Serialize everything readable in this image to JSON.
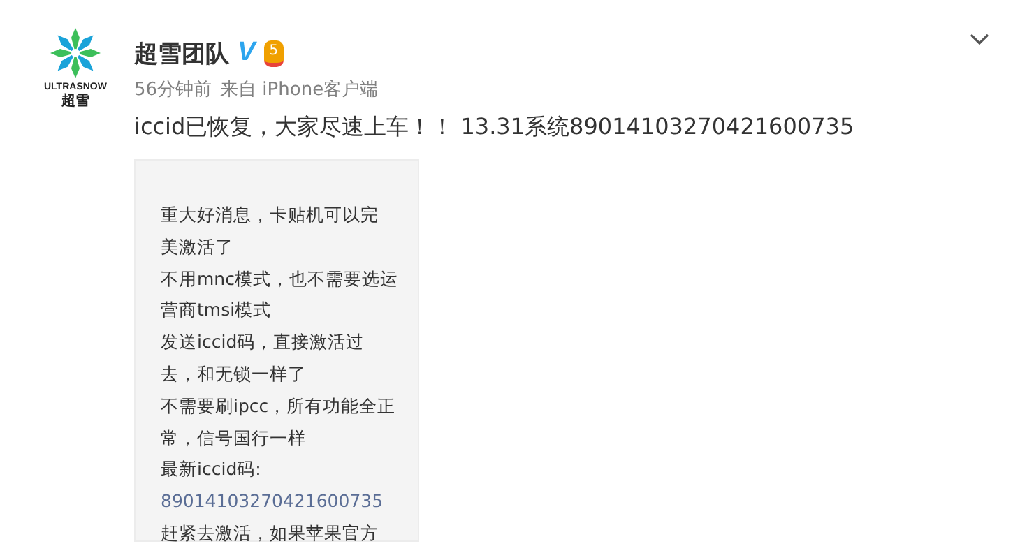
{
  "author": {
    "logo_text": "ULTRASNOW",
    "logo_subtext": "超雪",
    "name": "超雪团队",
    "verified_mark": "V",
    "badge": "5"
  },
  "meta": {
    "time": "56分钟前",
    "source": "来自 iPhone客户端"
  },
  "post_text": "iccid已恢复，大家尽速上车！！ 13.31系统89014103270421600735",
  "image_lines": [
    {
      "kind": "text",
      "text": "重大好消息，卡贴机可以完"
    },
    {
      "kind": "text",
      "text": "美激活了"
    },
    {
      "kind": "text",
      "text": "不用mnc模式，也不需要选运"
    },
    {
      "kind": "text",
      "text": "营商tmsi模式"
    },
    {
      "kind": "text",
      "text": "发送iccid码，直接激活过"
    },
    {
      "kind": "text",
      "text": "去，和无锁一样了"
    },
    {
      "kind": "text",
      "text": "不需要刷ipcc，所有功能全正"
    },
    {
      "kind": "text",
      "text": "常，信号国行一样"
    },
    {
      "kind": "text",
      "text": "最新iccid码:"
    },
    {
      "kind": "number",
      "text": "89014103270421600735"
    },
    {
      "kind": "text",
      "text": "赶紧去激活，如果苹果官方"
    }
  ]
}
